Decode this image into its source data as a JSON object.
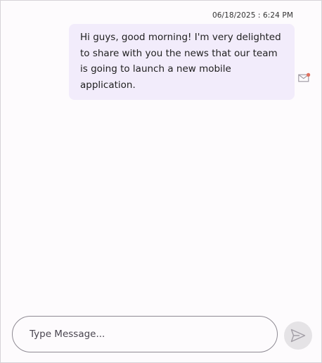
{
  "chat": {
    "messages": [
      {
        "timestamp": "06/18/2025 : 6:24 PM",
        "text": "Hi guys, good morning! I'm very delighted to share with you the news that our team is going to launch a new mobile application.",
        "status_icon": "envelope-icon"
      }
    ]
  },
  "composer": {
    "placeholder": "Type Message...",
    "value": "",
    "send_icon": "send-icon"
  },
  "colors": {
    "bubble_background": "#f2ecfb",
    "background": "#fdfbfd",
    "send_button_background": "#e5e3e6",
    "status_dot": "#e0705f"
  }
}
